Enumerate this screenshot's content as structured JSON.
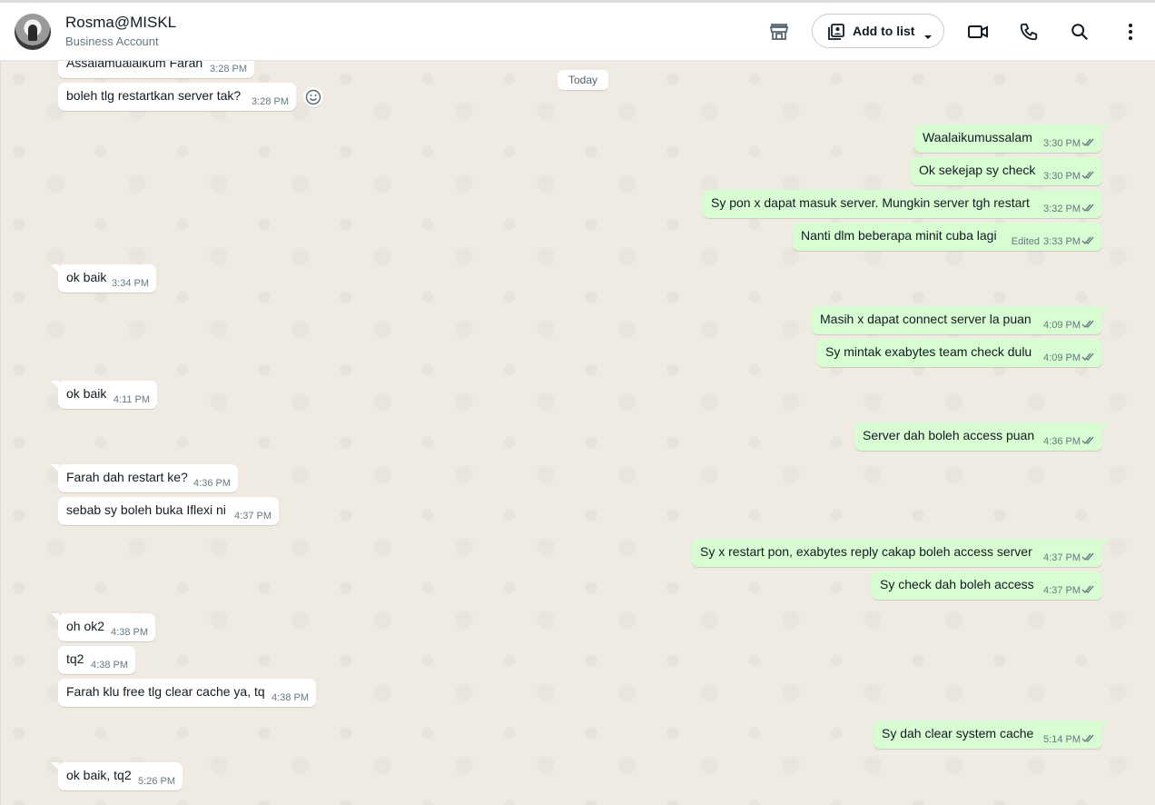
{
  "header": {
    "contact_name": "Rosma@MISKL",
    "contact_subtitle": "Business Account",
    "add_to_list_label": "Add to list",
    "icons": [
      "avatar",
      "storefront-icon",
      "contact-list-icon",
      "chevron-down-icon",
      "video-call-icon",
      "phone-icon",
      "search-icon",
      "more-options-icon"
    ]
  },
  "chat": {
    "day_separator": "Today",
    "edited_label": "Edited",
    "colors": {
      "incoming": "#ffffff",
      "outgoing": "#d9fdd3",
      "background": "#efeae2",
      "read_ticks": "#53bdeb"
    },
    "messages": [
      {
        "dir": "in",
        "text": "Assalamualaikum Farah",
        "time": "3:28 PM"
      },
      {
        "dir": "in",
        "text": "boleh tlg restartkan server tak?",
        "time": "3:28 PM"
      },
      {
        "dir": "out",
        "text": "Waalaikumussalam",
        "time": "3:30 PM"
      },
      {
        "dir": "out",
        "text": "Ok sekejap sy check",
        "time": "3:30 PM"
      },
      {
        "dir": "out",
        "text": "Sy pon x dapat masuk server. Mungkin server tgh restart",
        "time": "3:32 PM"
      },
      {
        "dir": "out",
        "text": "Nanti dlm beberapa minit cuba lagi",
        "time": "3:33 PM",
        "edited": true
      },
      {
        "dir": "in",
        "text": "ok baik",
        "time": "3:34 PM"
      },
      {
        "dir": "out",
        "text": "Masih x dapat connect server la puan",
        "time": "4:09 PM"
      },
      {
        "dir": "out",
        "text": "Sy mintak exabytes team check dulu",
        "time": "4:09 PM"
      },
      {
        "dir": "in",
        "text": "ok baik",
        "time": "4:11 PM"
      },
      {
        "dir": "out",
        "text": "Server dah boleh access puan",
        "time": "4:36 PM"
      },
      {
        "dir": "in",
        "text": "Farah dah restart ke?",
        "time": "4:36 PM"
      },
      {
        "dir": "in",
        "text": "sebab sy boleh buka Iflexi ni",
        "time": "4:37 PM"
      },
      {
        "dir": "out",
        "text": "Sy x restart pon, exabytes reply cakap boleh access server",
        "time": "4:37 PM"
      },
      {
        "dir": "out",
        "text": "Sy check dah boleh access",
        "time": "4:37 PM"
      },
      {
        "dir": "in",
        "text": "oh ok2",
        "time": "4:38 PM"
      },
      {
        "dir": "in",
        "text": "tq2",
        "time": "4:38 PM"
      },
      {
        "dir": "in",
        "text": "Farah klu free tlg clear cache ya, tq",
        "time": "4:38 PM"
      },
      {
        "dir": "out",
        "text": "Sy dah clear system cache",
        "time": "5:14 PM"
      },
      {
        "dir": "in",
        "text": "ok baik, tq2",
        "time": "5:26 PM"
      }
    ]
  }
}
